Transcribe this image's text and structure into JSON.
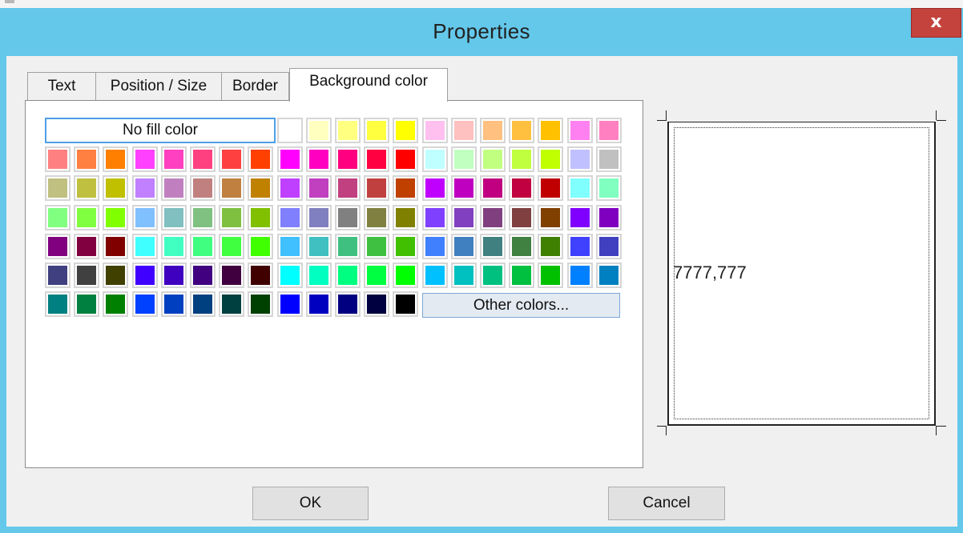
{
  "dialog": {
    "title": "Properties",
    "close_label": "x"
  },
  "tabs": [
    {
      "label": "Text"
    },
    {
      "label": "Position / Size"
    },
    {
      "label": "Border"
    },
    {
      "label": "Background color",
      "active": true
    }
  ],
  "palette": {
    "no_fill_label": "No fill color",
    "other_colors_label": "Other colors...",
    "row0": [
      "#ffffff",
      "#ffffc0",
      "#ffff80",
      "#ffff40",
      "#ffff00",
      "#ffc0f0",
      "#ffc0c0",
      "#ffc080",
      "#ffc040",
      "#ffc000",
      "#ff80f0",
      "#ff80c0"
    ],
    "rows": [
      [
        "#ff8080",
        "#ff8040",
        "#ff8000",
        "#ff40ff",
        "#ff40c0",
        "#ff4080",
        "#ff4040",
        "#ff4000",
        "#ff00ff",
        "#ff00c0",
        "#ff0080",
        "#ff0040",
        "#ff0000",
        "#c0ffff",
        "#c0ffc0",
        "#c0ff80",
        "#c0ff40",
        "#c0ff00",
        "#c0c0ff",
        "#c0c0c0"
      ],
      [
        "#c0c080",
        "#c0c040",
        "#c0c000",
        "#c080ff",
        "#c080c0",
        "#c08080",
        "#c08040",
        "#c08000",
        "#c040ff",
        "#c040c0",
        "#c04080",
        "#c04040",
        "#c04000",
        "#c000ff",
        "#c000c0",
        "#c00080",
        "#c00040",
        "#c00000",
        "#80ffff",
        "#80ffc0"
      ],
      [
        "#80ff80",
        "#80ff40",
        "#80ff00",
        "#80c0ff",
        "#80c0c0",
        "#80c080",
        "#80c040",
        "#80c000",
        "#8080ff",
        "#8080c0",
        "#808080",
        "#808040",
        "#808000",
        "#8040ff",
        "#8040c0",
        "#804080",
        "#804040",
        "#804000",
        "#8000ff",
        "#8000c0"
      ],
      [
        "#800080",
        "#800040",
        "#800000",
        "#40ffff",
        "#40ffc0",
        "#40ff80",
        "#40ff40",
        "#40ff00",
        "#40c0ff",
        "#40c0c0",
        "#40c080",
        "#40c040",
        "#40c000",
        "#4080ff",
        "#4080c0",
        "#408080",
        "#408040",
        "#408000",
        "#4040ff",
        "#4040c0"
      ],
      [
        "#404080",
        "#404040",
        "#404000",
        "#4000ff",
        "#4000c0",
        "#400080",
        "#400040",
        "#400000",
        "#00ffff",
        "#00ffc0",
        "#00ff80",
        "#00ff40",
        "#00ff00",
        "#00c0ff",
        "#00c0c0",
        "#00c080",
        "#00c040",
        "#00c000",
        "#0080ff",
        "#0080c0"
      ],
      [
        "#008080",
        "#008040",
        "#008000",
        "#0040ff",
        "#0040c0",
        "#004080",
        "#004040",
        "#004000",
        "#0000ff",
        "#0000c0",
        "#000080",
        "#000040",
        "#000000"
      ]
    ]
  },
  "preview": {
    "text": "7777,777"
  },
  "buttons": {
    "ok": "OK",
    "cancel": "Cancel"
  }
}
